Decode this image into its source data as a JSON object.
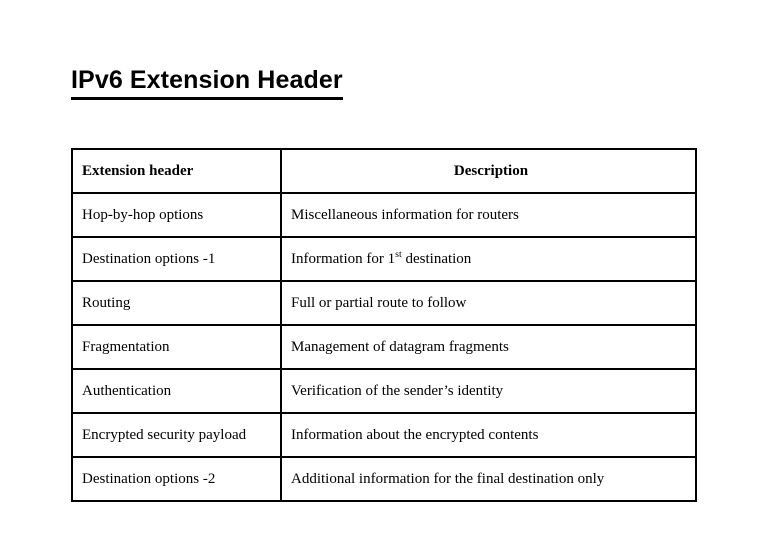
{
  "slide": {
    "title": "IPv6 Extension Header",
    "background_color": "#ffffff",
    "text_color": "#000000",
    "border_color": "#000000"
  },
  "table": {
    "columns": [
      {
        "key": "extension_header",
        "label": "Extension header",
        "align": "left"
      },
      {
        "key": "description",
        "label": "Description",
        "align": "center"
      }
    ],
    "rows": [
      {
        "extension_header": "Hop-by-hop options",
        "description": "Miscellaneous information for routers",
        "description_pre": "Miscellaneous information for routers",
        "description_sup": "",
        "description_post": ""
      },
      {
        "extension_header": "Destination options -1",
        "description": "Information for 1st destination",
        "description_pre": "Information for 1",
        "description_sup": "st",
        "description_post": " destination"
      },
      {
        "extension_header": "Routing",
        "description": "Full or partial route to follow",
        "description_pre": "Full or partial route to follow",
        "description_sup": "",
        "description_post": ""
      },
      {
        "extension_header": "Fragmentation",
        "description": "Management of datagram fragments",
        "description_pre": "Management of datagram fragments",
        "description_sup": "",
        "description_post": ""
      },
      {
        "extension_header": "Authentication",
        "description": "Verification of the sender’s identity",
        "description_pre": "Verification of the sender’s identity",
        "description_sup": "",
        "description_post": ""
      },
      {
        "extension_header": "Encrypted security payload",
        "description": "Information about the encrypted contents",
        "description_pre": "Information about the encrypted contents",
        "description_sup": "",
        "description_post": ""
      },
      {
        "extension_header": "Destination options -2",
        "description": "Additional information for the final destination only",
        "description_pre": "Additional information for the final destination only",
        "description_sup": "",
        "description_post": ""
      }
    ]
  }
}
